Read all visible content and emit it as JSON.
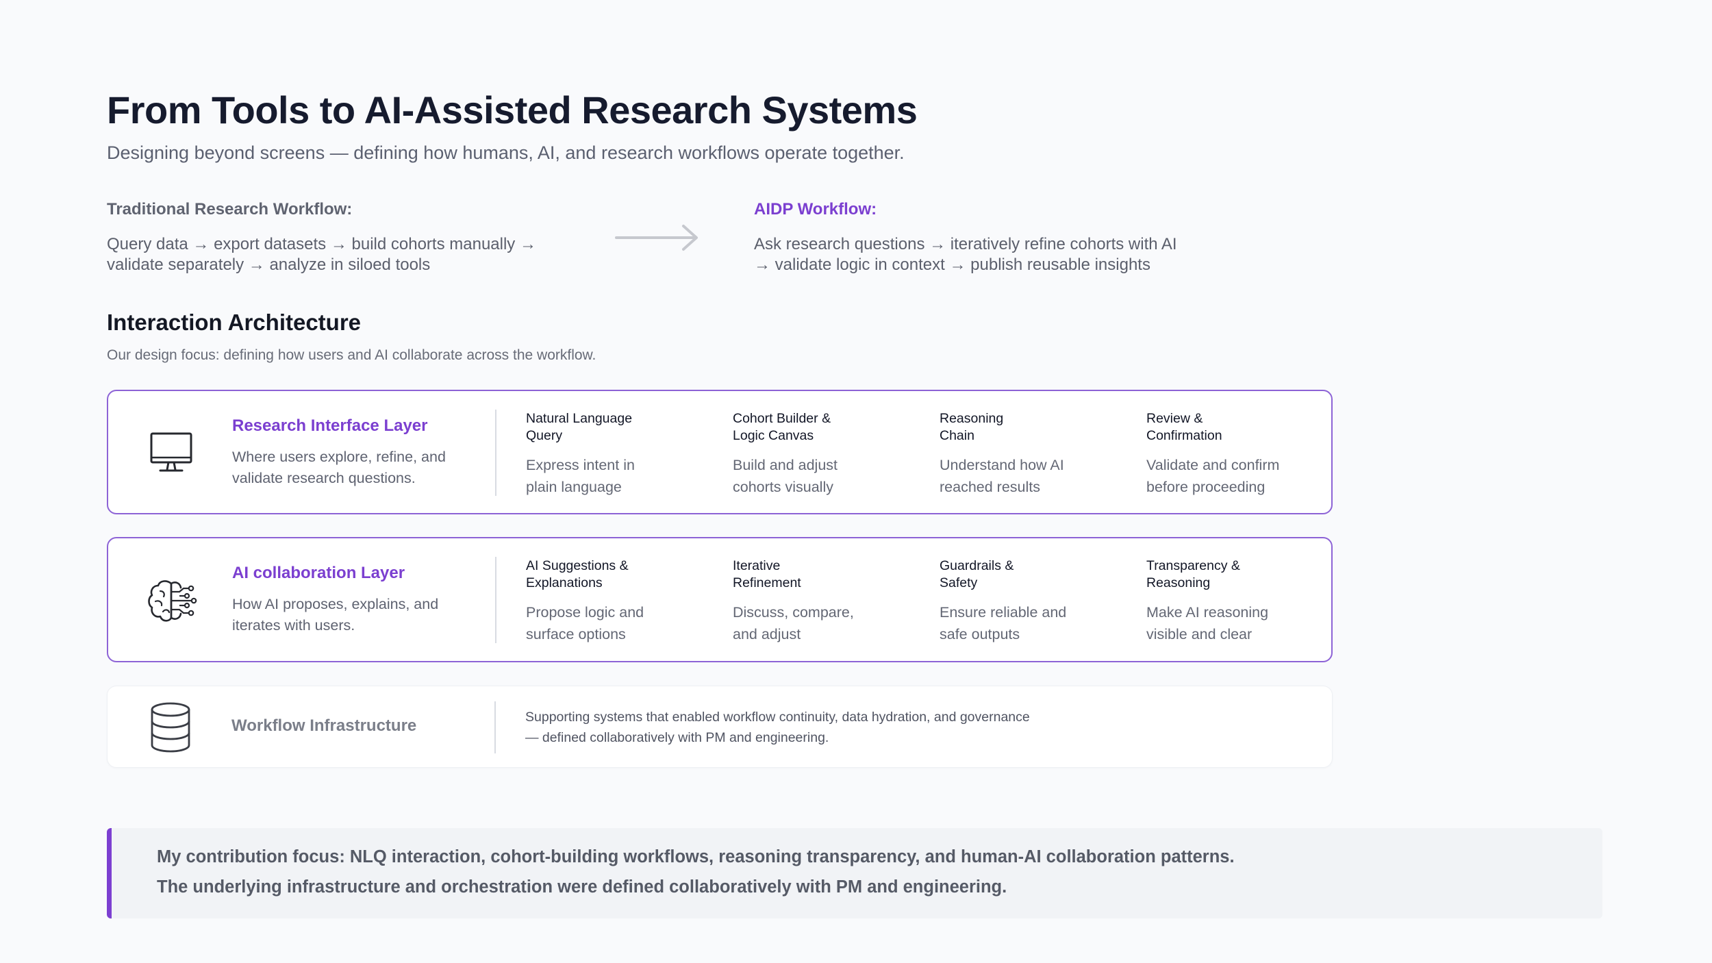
{
  "header": {
    "title": "From Tools to AI-Assisted Research Systems",
    "subtitle": "Designing beyond screens — defining how humans, AI, and research workflows operate together."
  },
  "workflows": {
    "traditional": {
      "label": "Traditional Research Workflow:",
      "line1": "Query data → export datasets → build cohorts manually →",
      "line2": "validate separately → analyze in siloed tools"
    },
    "arrow_icon": "arrow-right-icon",
    "aidp": {
      "label": "AIDP Workflow:",
      "line1": "Ask research questions → iteratively refine cohorts with AI",
      "line2": "→ validate logic in context → publish reusable insights"
    }
  },
  "architecture": {
    "title": "Interaction Architecture",
    "subtitle": "Our design focus: defining how users and AI collaborate across the workflow."
  },
  "layers": [
    {
      "icon": "monitor-icon",
      "name": "Research Interface Layer",
      "desc_line1": "Where users explore, refine, and",
      "desc_line2": "validate research questions.",
      "components": [
        {
          "title_line1": "Natural Language",
          "title_line2": "Query",
          "desc_line1": "Express intent in",
          "desc_line2": "plain language"
        },
        {
          "title_line1": "Cohort Builder &",
          "title_line2": "Logic Canvas",
          "desc_line1": "Build and adjust",
          "desc_line2": "cohorts visually"
        },
        {
          "title_line1": "Reasoning",
          "title_line2": "Chain",
          "desc_line1": "Understand how AI",
          "desc_line2": "reached results"
        },
        {
          "title_line1": "Review &",
          "title_line2": "Confirmation",
          "desc_line1": "Validate and confirm",
          "desc_line2": "before proceeding"
        }
      ]
    },
    {
      "icon": "brain-network-icon",
      "name": "AI collaboration Layer",
      "desc_line1": "How AI proposes, explains, and",
      "desc_line2": "iterates with users.",
      "components": [
        {
          "title_line1": "AI Suggestions &",
          "title_line2": "Explanations",
          "desc_line1": "Propose logic and",
          "desc_line2": "surface options"
        },
        {
          "title_line1": "Iterative",
          "title_line2": "Refinement",
          "desc_line1": "Discuss, compare,",
          "desc_line2": "and adjust"
        },
        {
          "title_line1": "Guardrails &",
          "title_line2": "Safety",
          "desc_line1": "Ensure reliable and",
          "desc_line2": "safe outputs"
        },
        {
          "title_line1": "Transparency &",
          "title_line2": "Reasoning",
          "desc_line1": "Make AI reasoning",
          "desc_line2": "visible and clear"
        }
      ]
    },
    {
      "icon": "database-icon",
      "name": "Workflow Infrastructure",
      "text_line1": "Supporting systems that enabled workflow continuity, data hydration, and governance",
      "text_line2": "— defined collaboratively with PM and engineering."
    }
  ],
  "contribution": {
    "line1": "My contribution focus: NLQ interaction, cohort-building workflows, reasoning transparency, and human-AI collaboration patterns.",
    "line2": "The underlying infrastructure and orchestration were defined collaboratively with PM and engineering."
  },
  "colors": {
    "accent": "#7b3fd0",
    "layer_border": "#8d63d6",
    "background": "#f9fafc"
  }
}
